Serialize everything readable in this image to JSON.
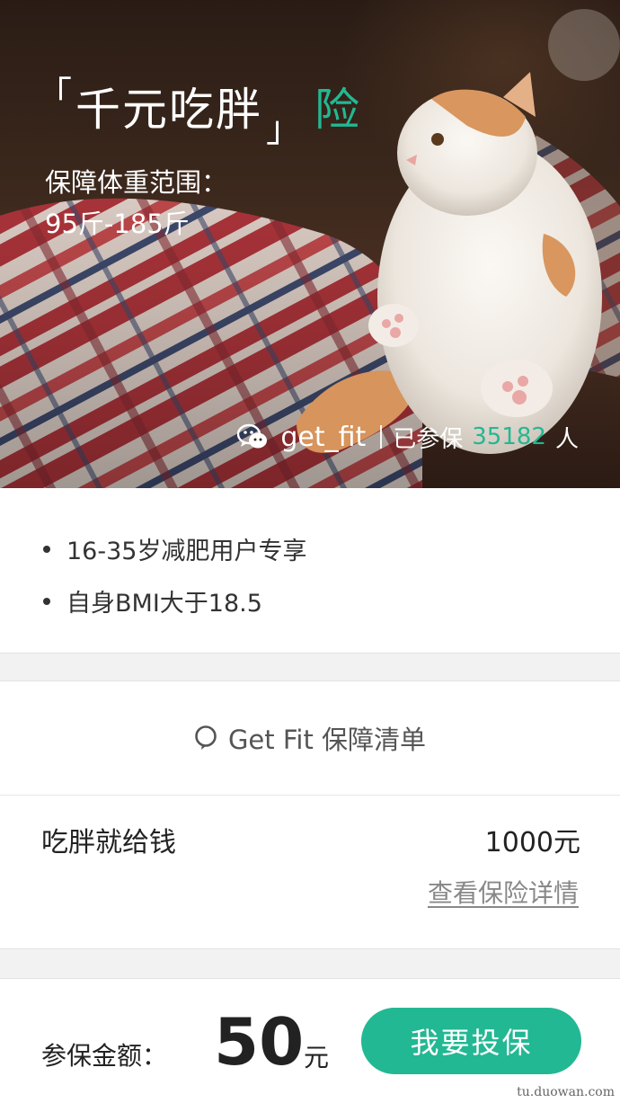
{
  "hero": {
    "bracket_open": "「",
    "title": "千元吃胖",
    "bracket_close": "」",
    "title_accent": "险",
    "range_label": "保障体重范围：",
    "range_value": "95斤-185斤",
    "social": {
      "icon": "wechat-icon",
      "handle": "get_fit",
      "joined_text": "已参保",
      "joined_count": "35182",
      "joined_unit": "人"
    }
  },
  "features": [
    "16-35岁减肥用户专享",
    "自身BMI大于18.5"
  ],
  "coverage": {
    "icon": "chat-bubble-icon",
    "title": "Get Fit 保障清单",
    "item_name": "吃胖就给钱",
    "item_amount": "1000元",
    "details_link": "查看保险详情"
  },
  "purchase": {
    "price_label": "参保金额：",
    "price_value": "50",
    "price_unit": "元",
    "buy_label": "我要投保"
  },
  "watermark": "tu.duowan.com",
  "colors": {
    "accent": "#22b893",
    "text": "#333333",
    "background": "#f2f2f2"
  }
}
